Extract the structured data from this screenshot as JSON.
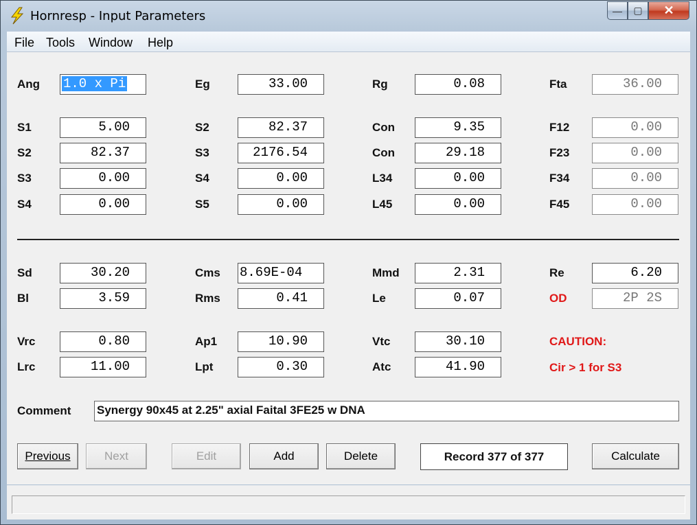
{
  "window": {
    "title": "Hornresp - Input Parameters",
    "controls": {
      "minimize": "—",
      "maximize": "▢",
      "close": "✕"
    }
  },
  "menu": [
    "File",
    "Tools",
    "Window",
    "Help"
  ],
  "rows": [
    {
      "cols": [
        {
          "label": "Ang",
          "value": "1.0 x Pi",
          "selected": true
        },
        {
          "label": "Eg",
          "value": "33.00"
        },
        {
          "label": "Rg",
          "value": "0.08"
        },
        {
          "label": "Fta",
          "value": "36.00",
          "disabled": true
        }
      ]
    },
    {
      "cols": [
        {
          "label": "S1",
          "value": "5.00"
        },
        {
          "label": "S2",
          "value": "82.37"
        },
        {
          "label": "Con",
          "value": "9.35"
        },
        {
          "label": "F12",
          "value": "0.00",
          "disabled": true
        }
      ]
    },
    {
      "cols": [
        {
          "label": "S2",
          "value": "82.37"
        },
        {
          "label": "S3",
          "value": "2176.54"
        },
        {
          "label": "Con",
          "value": "29.18"
        },
        {
          "label": "F23",
          "value": "0.00",
          "disabled": true
        }
      ]
    },
    {
      "cols": [
        {
          "label": "S3",
          "value": "0.00"
        },
        {
          "label": "S4",
          "value": "0.00"
        },
        {
          "label": "L34",
          "value": "0.00"
        },
        {
          "label": "F34",
          "value": "0.00",
          "disabled": true
        }
      ]
    },
    {
      "cols": [
        {
          "label": "S4",
          "value": "0.00"
        },
        {
          "label": "S5",
          "value": "0.00"
        },
        {
          "label": "L45",
          "value": "0.00"
        },
        {
          "label": "F45",
          "value": "0.00",
          "disabled": true
        }
      ]
    },
    {
      "cols": [
        {
          "label": "Sd",
          "value": "30.20"
        },
        {
          "label": "Cms",
          "value": "8.69E-04",
          "left": true
        },
        {
          "label": "Mmd",
          "value": "2.31"
        },
        {
          "label": "Re",
          "value": "6.20"
        }
      ]
    },
    {
      "cols": [
        {
          "label": "Bl",
          "value": "3.59"
        },
        {
          "label": "Rms",
          "value": "0.41"
        },
        {
          "label": "Le",
          "value": "0.07"
        },
        {
          "label": "OD",
          "value": "2P 2S",
          "disabled": true,
          "red_label": true
        }
      ]
    },
    {
      "cols": [
        {
          "label": "Vrc",
          "value": "0.80"
        },
        {
          "label": "Ap1",
          "value": "10.90"
        },
        {
          "label": "Vtc",
          "value": "30.10"
        }
      ]
    },
    {
      "cols": [
        {
          "label": "Lrc",
          "value": "11.00"
        },
        {
          "label": "Lpt",
          "value": "0.30"
        },
        {
          "label": "Atc",
          "value": "41.90"
        }
      ]
    }
  ],
  "caution": {
    "title": "CAUTION:",
    "message": "Cir > 1 for S3"
  },
  "comment": {
    "label": "Comment",
    "value": "Synergy 90x45 at 2.25\" axial Faital 3FE25 w DNA"
  },
  "buttons": [
    {
      "label": "Previous",
      "enabled": true
    },
    {
      "label": "Next",
      "enabled": false
    },
    {
      "label": "Edit",
      "enabled": false
    },
    {
      "label": "Add",
      "enabled": true
    },
    {
      "label": "Delete",
      "enabled": true
    },
    {
      "label": "Calculate",
      "enabled": true
    }
  ],
  "record": "Record 377 of 377",
  "status_text": ""
}
